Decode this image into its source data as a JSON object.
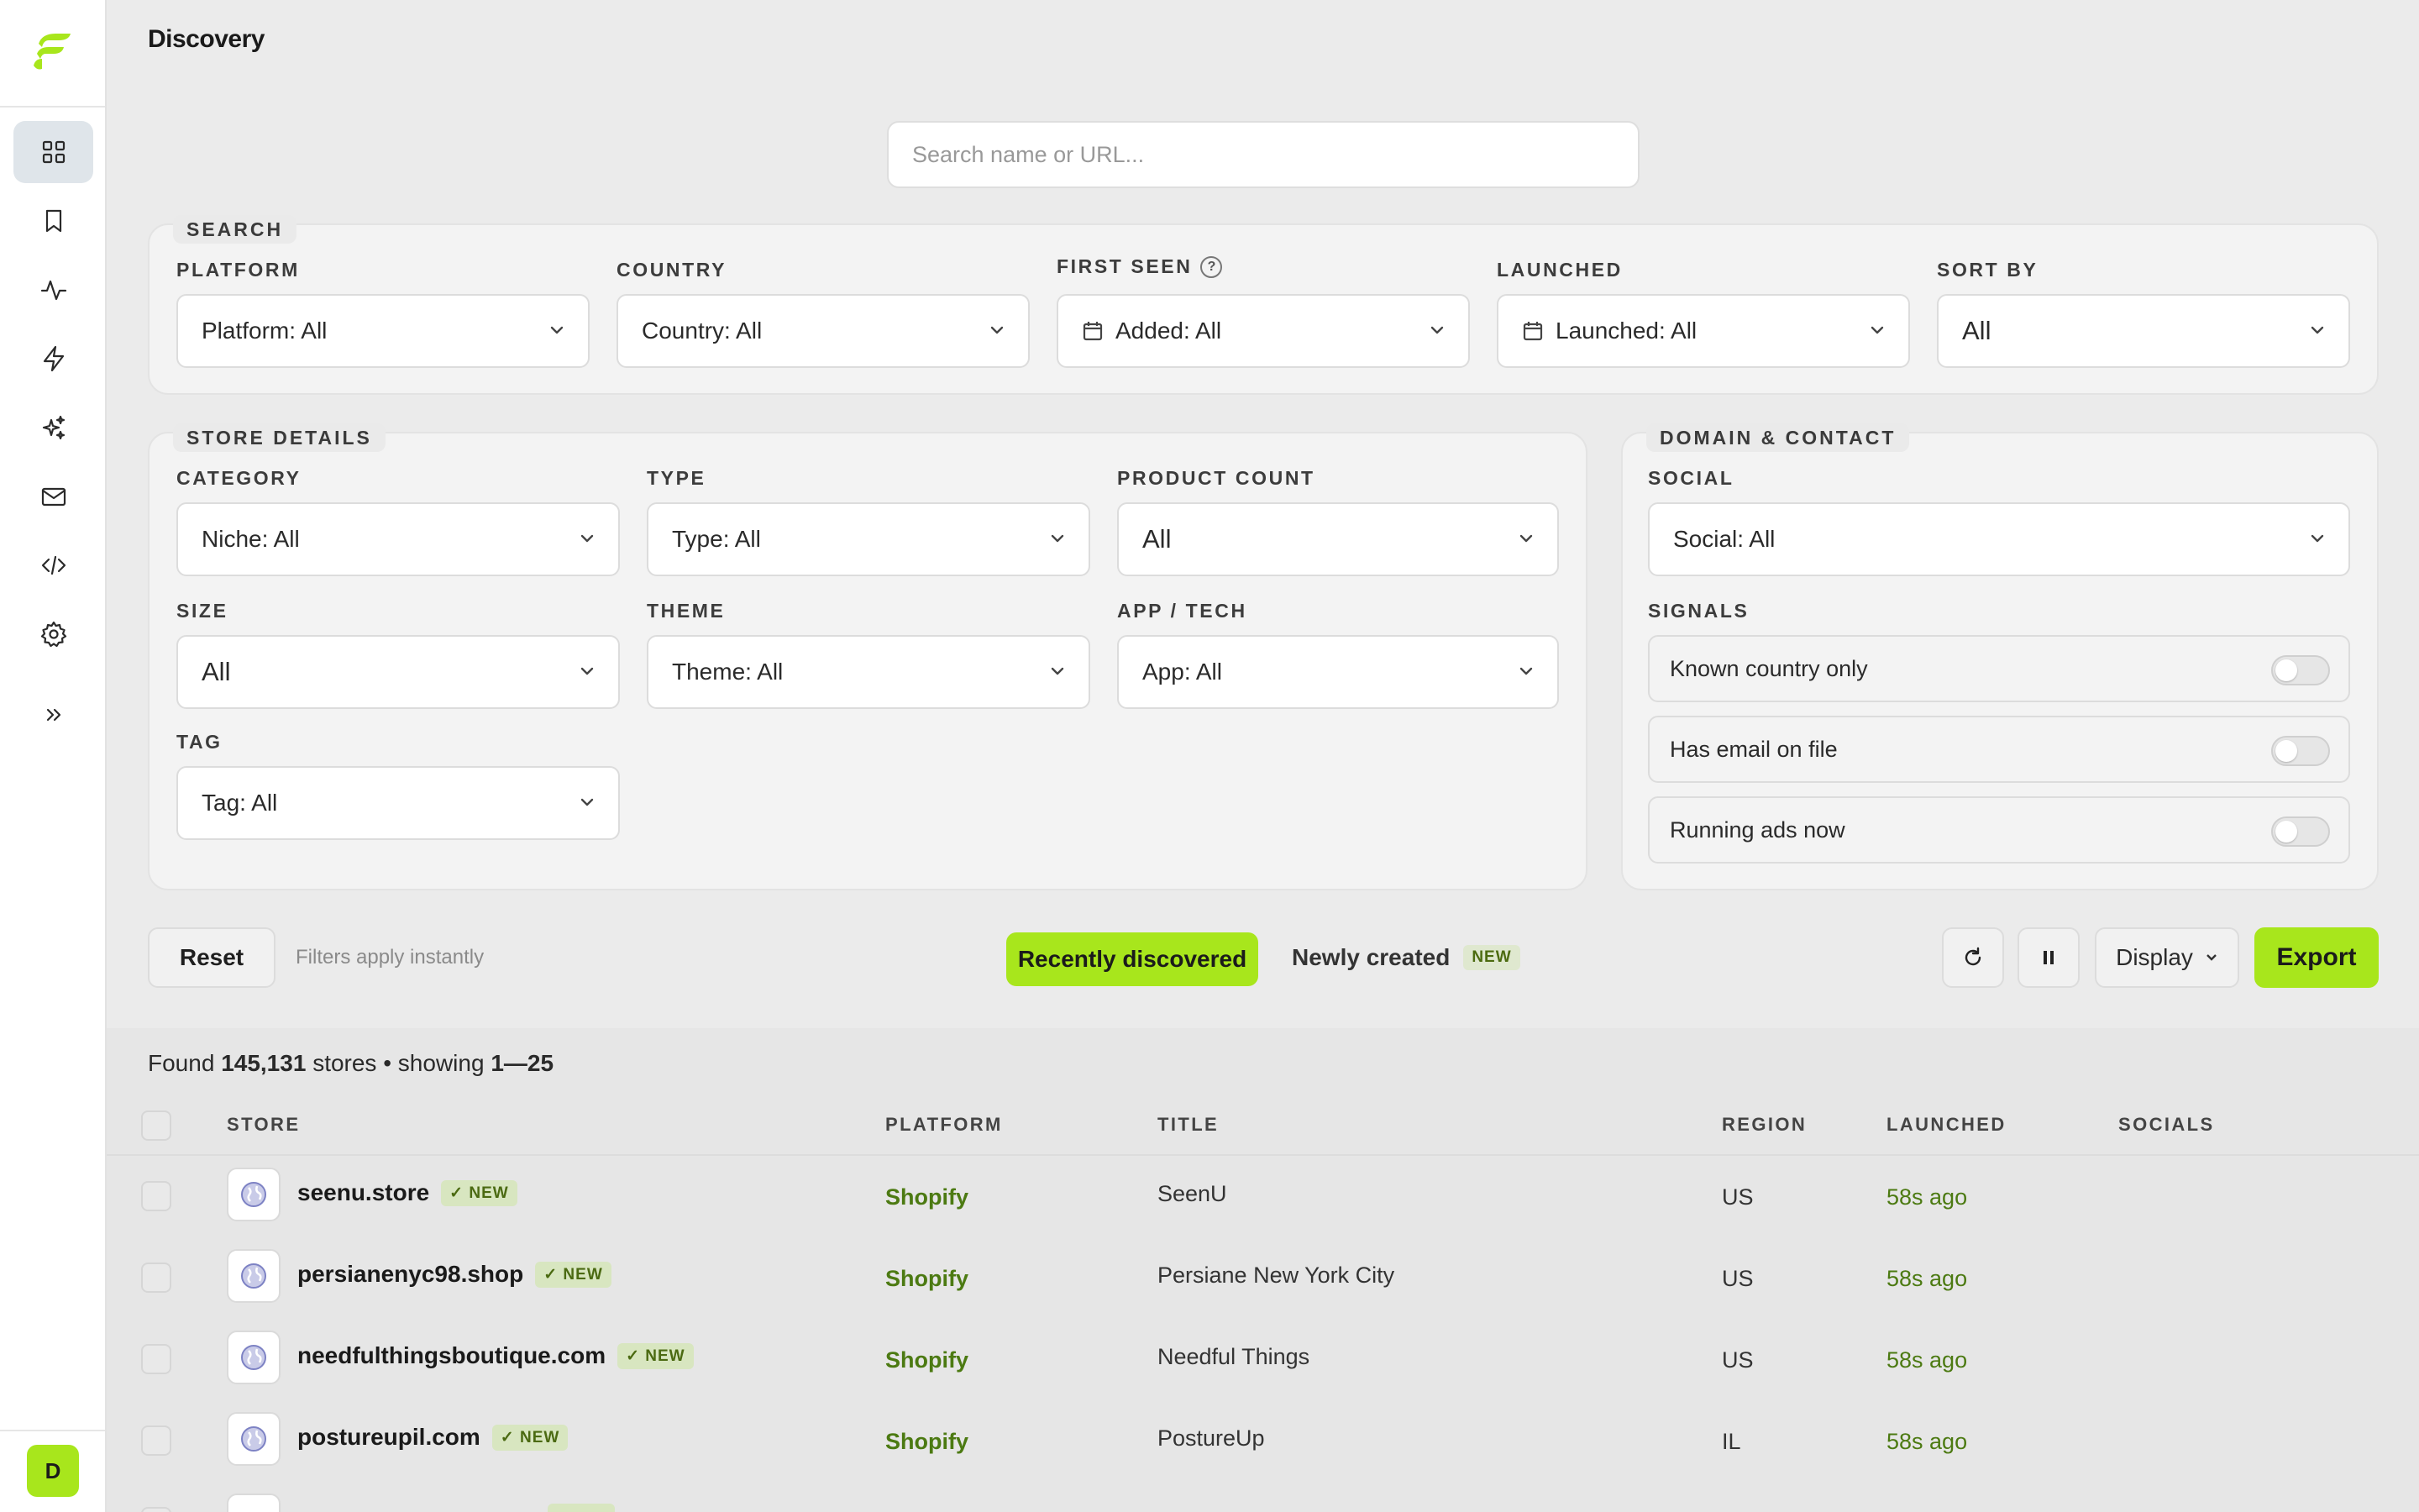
{
  "app": {
    "page_title": "Discovery",
    "avatar_initial": "D",
    "brand_color": "#a8e61c"
  },
  "sidebar": {
    "items": [
      {
        "name": "dashboard",
        "icon": "grid-icon",
        "active": true
      },
      {
        "name": "saved",
        "icon": "bookmark-icon",
        "active": false
      },
      {
        "name": "activity",
        "icon": "pulse-icon",
        "active": false
      },
      {
        "name": "triggers",
        "icon": "lightning-icon",
        "active": false
      },
      {
        "name": "ai",
        "icon": "sparkles-icon",
        "active": false
      },
      {
        "name": "mail",
        "icon": "mail-icon",
        "active": false
      },
      {
        "name": "code",
        "icon": "code-icon",
        "active": false
      },
      {
        "name": "settings",
        "icon": "gear-icon",
        "active": false
      },
      {
        "name": "expand",
        "icon": "chevrons-right-icon",
        "active": false
      }
    ]
  },
  "search": {
    "placeholder": "Search name or URL..."
  },
  "filters": {
    "search_panel": {
      "title": "SEARCH",
      "platform": {
        "label": "PLATFORM",
        "value": "Platform: All"
      },
      "country": {
        "label": "COUNTRY",
        "value": "Country: All"
      },
      "first_seen": {
        "label": "FIRST SEEN",
        "help": "?",
        "value": "Added: All"
      },
      "launched": {
        "label": "LAUNCHED",
        "value": "Launched: All"
      },
      "sort_by": {
        "label": "SORT BY",
        "value": "All"
      }
    },
    "store_details": {
      "title": "STORE DETAILS",
      "category": {
        "label": "CATEGORY",
        "value": "Niche: All"
      },
      "type": {
        "label": "TYPE",
        "value": "Type: All"
      },
      "product_count": {
        "label": "PRODUCT COUNT",
        "value": "All"
      },
      "size": {
        "label": "SIZE",
        "value": "All"
      },
      "theme": {
        "label": "THEME",
        "value": "Theme: All"
      },
      "app_tech": {
        "label": "APP / TECH",
        "value": "App: All"
      },
      "tag": {
        "label": "TAG",
        "value": "Tag: All"
      }
    },
    "domain_contact": {
      "title": "DOMAIN & CONTACT",
      "social": {
        "label": "SOCIAL",
        "value": "Social: All"
      },
      "signals_label": "SIGNALS",
      "signals": [
        {
          "label": "Known country only",
          "on": false
        },
        {
          "label": "Has email on file",
          "on": false
        },
        {
          "label": "Running ads now",
          "on": false
        }
      ]
    }
  },
  "actions": {
    "reset": "Reset",
    "hint": "Filters apply instantly",
    "recently_discovered": "Recently discovered",
    "newly_created": "Newly created",
    "new_tag": "NEW",
    "display": "Display",
    "export": "Export"
  },
  "results": {
    "found_prefix": "Found",
    "count": "145,131",
    "middle": "stores • showing",
    "range": "1—25",
    "columns": [
      "STORE",
      "PLATFORM",
      "TITLE",
      "REGION",
      "LAUNCHED",
      "SOCIALS"
    ],
    "rows": [
      {
        "store": "seenu.store",
        "tag": "✓ NEW",
        "platform": "Shopify",
        "title": "SeenU",
        "region": "US",
        "launched": "58s ago"
      },
      {
        "store": "persianenyc98.shop",
        "tag": "✓ NEW",
        "platform": "Shopify",
        "title": "Persiane New York City",
        "region": "US",
        "launched": "58s ago"
      },
      {
        "store": "needfulthingsboutique.com",
        "tag": "✓ NEW",
        "platform": "Shopify",
        "title": "Needful Things",
        "region": "US",
        "launched": "58s ago"
      },
      {
        "store": "postureupil.com",
        "tag": "✓ NEW",
        "platform": "Shopify",
        "title": "PostureUp",
        "region": "IL",
        "launched": "58s ago"
      }
    ]
  }
}
